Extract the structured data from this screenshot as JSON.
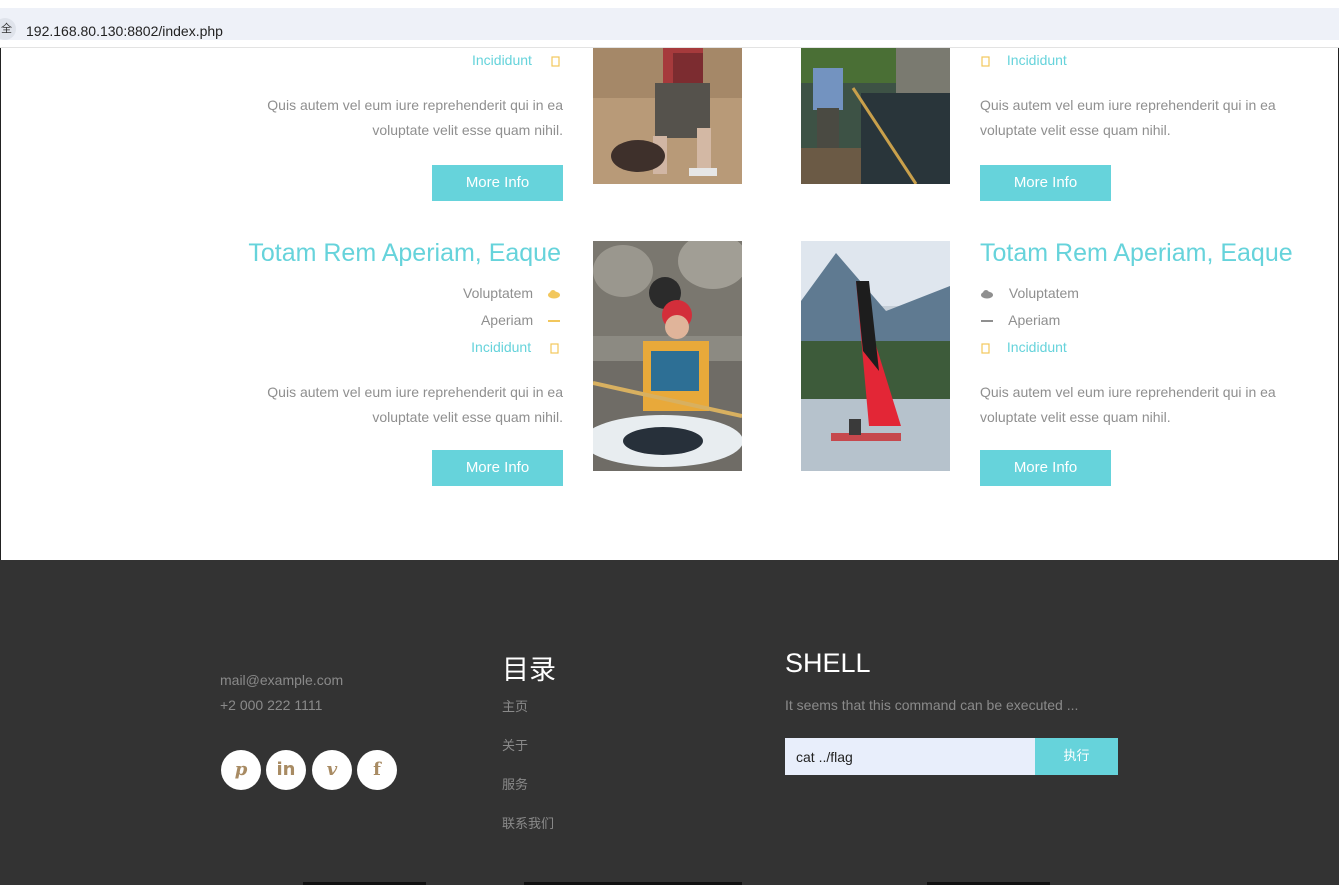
{
  "browser": {
    "security_label": "全",
    "url": "192.168.80.130:8802/index.php"
  },
  "cards": {
    "left_top": {
      "accent_item": "Incididunt",
      "description": "Quis autem vel eum iure reprehenderit qui in ea voluptate velit esse quam nihil.",
      "button": "More Info"
    },
    "right_top": {
      "accent_item": "Incididunt",
      "description": "Quis autem vel eum iure reprehenderit qui in ea voluptate velit esse quam nihil.",
      "button": "More Info"
    },
    "left_bottom": {
      "title": "Totam Rem Aperiam, Eaque",
      "items": [
        "Voluptatem",
        "Aperiam"
      ],
      "accent_item": "Incididunt",
      "description": "Quis autem vel eum iure reprehenderit qui in ea voluptate velit esse quam nihil.",
      "button": "More Info"
    },
    "right_bottom": {
      "title": "Totam Rem Aperiam, Eaque",
      "items": [
        "Voluptatem",
        "Aperiam"
      ],
      "accent_item": "Incididunt",
      "description": "Quis autem vel eum iure reprehenderit qui in ea voluptate velit esse quam nihil.",
      "button": "More Info"
    }
  },
  "footer": {
    "email": "mail@example.com",
    "phone": "+2 000 222 1111",
    "social": [
      {
        "icon": "pinterest-icon",
        "glyph": "p"
      },
      {
        "icon": "linkedin-icon",
        "glyph": "in"
      },
      {
        "icon": "vimeo-icon",
        "glyph": "v"
      },
      {
        "icon": "facebook-icon",
        "glyph": "f"
      }
    ],
    "menu": {
      "heading": "目录",
      "items": [
        "主页",
        "关于",
        "服务",
        "联系我们"
      ]
    },
    "shell": {
      "heading": "SHELL",
      "subtitle": "It seems that this command can be executed ...",
      "input_value": "cat ../flag",
      "button": "执行"
    }
  },
  "colors": {
    "accent": "#66d3db",
    "footer_bg": "#333333",
    "icon_gold": "#f2c75c",
    "social_icon": "#a88b63"
  }
}
